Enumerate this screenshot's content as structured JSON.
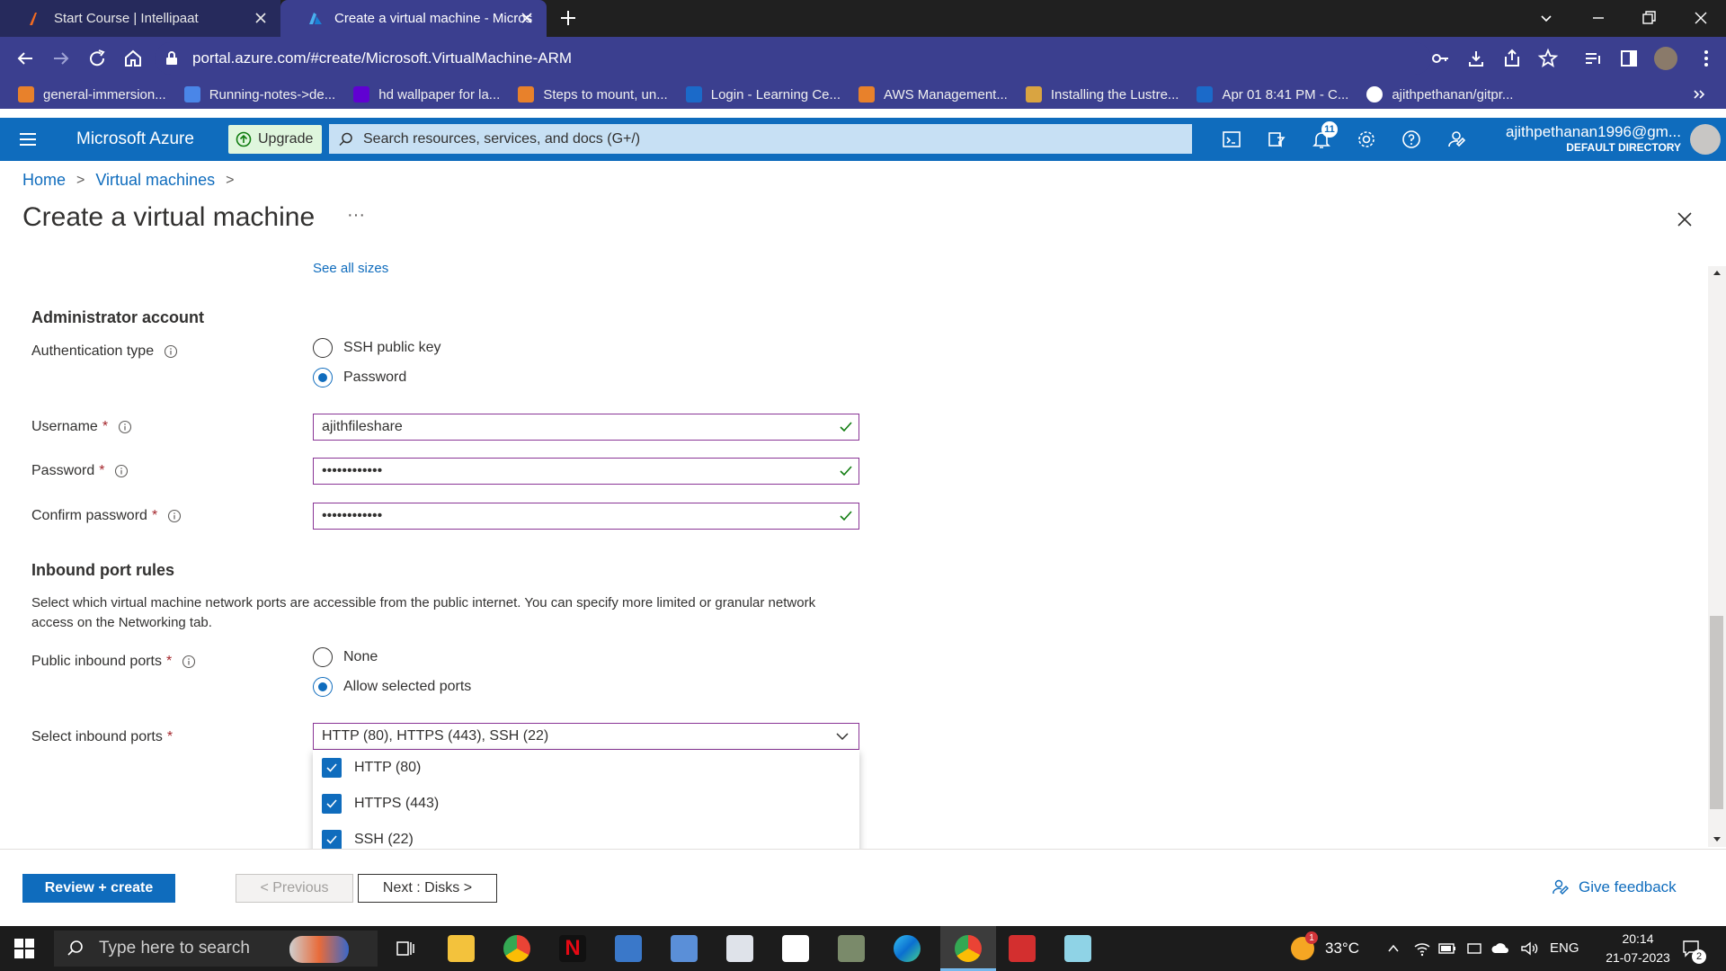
{
  "browser": {
    "tabs": [
      {
        "title": "Start Course | Intellipaat",
        "active": false
      },
      {
        "title": "Create a virtual machine - Micros",
        "active": true
      }
    ],
    "url": "portal.azure.com/#create/Microsoft.VirtualMachine-ARM",
    "bookmarks": [
      {
        "label": "general-immersion...",
        "icon": "orange-cube-icon",
        "color": "#e8812b"
      },
      {
        "label": "Running-notes->de...",
        "icon": "doc-icon",
        "color": "#4a86e8"
      },
      {
        "label": "hd wallpaper for la...",
        "icon": "yahoo-icon",
        "color": "#6001d2"
      },
      {
        "label": "Steps to mount, un...",
        "icon": "orange-cube-icon",
        "color": "#e8812b"
      },
      {
        "label": "Login - Learning Ce...",
        "icon": "x-logo-icon",
        "color": "#1b6ac9"
      },
      {
        "label": "AWS Management...",
        "icon": "orange-cube-icon",
        "color": "#e8812b"
      },
      {
        "label": "Installing the Lustre...",
        "icon": "box-icon",
        "color": "#d9a441"
      },
      {
        "label": "Apr 01 8:41 PM - C...",
        "icon": "scissor-icon",
        "color": "#1b6ac9"
      },
      {
        "label": "ajithpethanan/gitpr...",
        "icon": "github-icon",
        "color": "#ffffff"
      }
    ]
  },
  "azure_header": {
    "brand": "Microsoft Azure",
    "upgrade_label": "Upgrade",
    "search_placeholder": "Search resources, services, and docs (G+/)",
    "notification_count": "11",
    "account_email": "ajithpethanan1996@gm...",
    "account_directory": "DEFAULT DIRECTORY"
  },
  "breadcrumb": [
    "Home",
    "Virtual machines"
  ],
  "page": {
    "title": "Create a virtual machine",
    "more": "···",
    "see_all_sizes": "See all sizes"
  },
  "admin": {
    "heading": "Administrator account",
    "auth_type_label": "Authentication type",
    "auth_options": [
      "SSH public key",
      "Password"
    ],
    "auth_selected": "Password",
    "username_label": "Username",
    "username_value": "ajithfileshare",
    "password_label": "Password",
    "password_value": "••••••••••••",
    "confirm_label": "Confirm password",
    "confirm_value": "••••••••••••",
    "required_mark": "*"
  },
  "inbound": {
    "heading": "Inbound port rules",
    "description": "Select which virtual machine network ports are accessible from the public internet. You can specify more limited or granular network access on the Networking tab.",
    "public_label": "Public inbound ports",
    "public_options": [
      "None",
      "Allow selected ports"
    ],
    "public_selected": "Allow selected ports",
    "select_label": "Select inbound ports",
    "select_value": "HTTP (80), HTTPS (443), SSH (22)",
    "port_options": [
      {
        "label": "HTTP (80)",
        "checked": true
      },
      {
        "label": "HTTPS (443)",
        "checked": true
      },
      {
        "label": "SSH (22)",
        "checked": true
      }
    ]
  },
  "footer": {
    "review_label": "Review + create",
    "previous_label": "< Previous",
    "next_label": "Next : Disks >",
    "feedback_label": "Give feedback"
  },
  "taskbar": {
    "search_placeholder": "Type here to search",
    "temperature": "33°C",
    "weather_badge": "1",
    "language": "ENG",
    "time": "20:14",
    "date": "21-07-2023",
    "notification_count": "2"
  },
  "colors": {
    "azure_blue": "#0f6cbd",
    "chrome_tab_bg": "#262a5c",
    "chrome_toolbar": "#3b3f8f",
    "field_border": "#8a3596",
    "valid_check": "#107c10",
    "required": "#a4262c"
  }
}
